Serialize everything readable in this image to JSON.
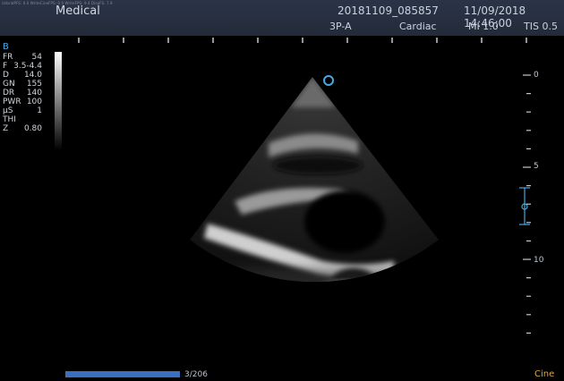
{
  "header": {
    "debug_line": "UsbridPFS: 0.0   WriteCineFPS: 0.0   WriteFPS: 9.4   DispFS: 7.9",
    "app_name": "Medical",
    "study_id": "20181109_085857",
    "datetime": "11/09/2018 14:46:00",
    "probe": "3P-A",
    "preset": "Cardiac",
    "mi": "MI 1.0",
    "tis": "TIS 0.5"
  },
  "mode_label": "B",
  "params": [
    {
      "key": "FR",
      "value": "54"
    },
    {
      "key": "F",
      "value": "3.5-4.4"
    },
    {
      "key": "D",
      "value": "14.0"
    },
    {
      "key": "GN",
      "value": "155"
    },
    {
      "key": "DR",
      "value": "140"
    },
    {
      "key": "PWR",
      "value": "100"
    },
    {
      "key": "µS",
      "value": "1"
    },
    {
      "key": "THI",
      "value": ""
    },
    {
      "key": "Z",
      "value": "0.80"
    }
  ],
  "depth_labels": [
    "0",
    "5",
    "10"
  ],
  "cine": {
    "progress": 1.0,
    "frame_counter": "3/206",
    "label": "Cine"
  },
  "colors": {
    "header_bg": "#2b3446",
    "mode_label": "#4aa8e0",
    "focus_marker": "#4aa8e0",
    "cine_label": "#e0a640",
    "cine_bar": "#3a6fc2"
  },
  "icons": {
    "orientation_marker": "probe-orientation-icon",
    "focus_marker": "focus-marker-icon"
  }
}
